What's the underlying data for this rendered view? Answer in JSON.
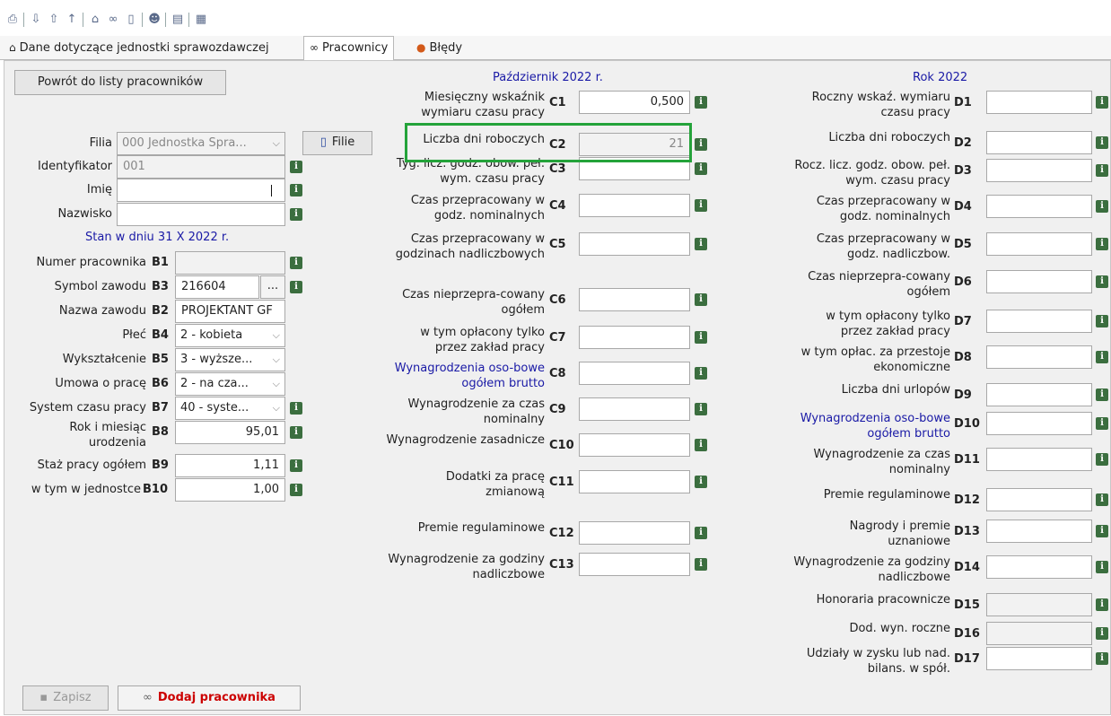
{
  "toolbar": {
    "icons": [
      "print-icon",
      "import-icon",
      "export-icon",
      "upload-icon",
      "home-icon",
      "glasses-icon",
      "bookmark-icon",
      "users-icon",
      "document-icon",
      "binary-icon"
    ]
  },
  "tabs": [
    {
      "label": "Dane dotyczące jednostki sprawozdawczej"
    },
    {
      "label": "Pracownicy"
    },
    {
      "label": "Błędy"
    }
  ],
  "left": {
    "back_button": "Powrót do listy pracowników",
    "filia_label": "Filia",
    "filia_value": "000 Jednostka Spra...",
    "filie_button": "Filie",
    "identyfikator_label": "Identyfikator",
    "identyfikator_value": "001",
    "imie_label": "Imię",
    "imie_value": "",
    "nazwisko_label": "Nazwisko",
    "nazwisko_value": "",
    "stan_header": "Stan w dniu 31 X 2022 r.",
    "rows": [
      {
        "label": "Numer pracownika",
        "code": "B1",
        "value": ""
      },
      {
        "label": "Symbol zawodu",
        "code": "B3",
        "value": "216604",
        "extra": "..."
      },
      {
        "label": "Nazwa zawodu",
        "code": "B2",
        "value": "PROJEKTANT GF"
      },
      {
        "label": "Płeć",
        "code": "B4",
        "value": "2 - kobieta"
      },
      {
        "label": "Wykształcenie",
        "code": "B5",
        "value": "3 - wyższe..."
      },
      {
        "label": "Umowa o pracę",
        "code": "B6",
        "value": "2 - na cza..."
      },
      {
        "label": "System czasu pracy",
        "code": "B7",
        "value": "40 - syste..."
      },
      {
        "label": "Rok i miesiąc urodzenia",
        "code": "B8",
        "value": "95,01"
      },
      {
        "label": "Staż pracy ogółem",
        "code": "B9",
        "value": "1,11"
      },
      {
        "label": "w tym w jednostce",
        "code": "B10",
        "value": "1,00"
      }
    ],
    "save_button": "Zapisz",
    "add_button": "Dodaj pracownika"
  },
  "middle": {
    "header": "Październik 2022 r.",
    "rows": [
      {
        "label": "Miesięczny wskaźnik wymiaru czasu pracy",
        "code": "C1",
        "value": "0,500"
      },
      {
        "label": "Liczba dni roboczych",
        "code": "C2",
        "value": "21"
      },
      {
        "label": "Tyg. licz. godz. obow. peł. wym. czasu pracy",
        "code": "C3",
        "value": ""
      },
      {
        "label": "Czas przepracowany w godz. nominalnych",
        "code": "C4",
        "value": ""
      },
      {
        "label": "Czas przepracowany w godzinach nadliczbowych",
        "code": "C5",
        "value": ""
      },
      {
        "label": "Czas nieprzepra-cowany ogółem",
        "code": "C6",
        "value": ""
      },
      {
        "label": "w tym opłacony tylko przez zakład pracy",
        "code": "C7",
        "value": ""
      },
      {
        "label": "Wynagrodzenia oso-bowe ogółem brutto",
        "code": "C8",
        "value": ""
      },
      {
        "label": "Wynagrodzenie za czas nominalny",
        "code": "C9",
        "value": ""
      },
      {
        "label": "Wynagrodzenie zasadnicze",
        "code": "C10",
        "value": ""
      },
      {
        "label": "Dodatki za pracę zmianową",
        "code": "C11",
        "value": ""
      },
      {
        "label": "Premie regulaminowe",
        "code": "C12",
        "value": ""
      },
      {
        "label": "Wynagrodzenie za godziny nadliczbowe",
        "code": "C13",
        "value": ""
      }
    ]
  },
  "right": {
    "header": "Rok 2022",
    "rows": [
      {
        "label": "Roczny wskaź. wymiaru czasu pracy",
        "code": "D1",
        "value": ""
      },
      {
        "label": "Liczba dni roboczych",
        "code": "D2",
        "value": ""
      },
      {
        "label": "Rocz. licz. godz. obow. peł. wym. czasu pracy",
        "code": "D3",
        "value": ""
      },
      {
        "label": "Czas przepracowany w godz. nominalnych",
        "code": "D4",
        "value": ""
      },
      {
        "label": "Czas przepracowany w godz. nadliczbow.",
        "code": "D5",
        "value": ""
      },
      {
        "label": "Czas nieprzepra-cowany ogółem",
        "code": "D6",
        "value": ""
      },
      {
        "label": "w tym opłacony tylko przez zakład pracy",
        "code": "D7",
        "value": ""
      },
      {
        "label": "w tym opłac. za przestoje ekonomiczne",
        "code": "D8",
        "value": ""
      },
      {
        "label": "Liczba dni urlopów",
        "code": "D9",
        "value": ""
      },
      {
        "label": "Wynagrodzenia oso-bowe ogółem brutto",
        "code": "D10",
        "value": ""
      },
      {
        "label": "Wynagrodzenie za czas nominalny",
        "code": "D11",
        "value": ""
      },
      {
        "label": "Premie regulaminowe",
        "code": "D12",
        "value": ""
      },
      {
        "label": "Nagrody i premie uznaniowe",
        "code": "D13",
        "value": ""
      },
      {
        "label": "Wynagrodzenie za godziny nadliczbowe",
        "code": "D14",
        "value": ""
      },
      {
        "label": "Honoraria pracownicze",
        "code": "D15",
        "value": ""
      },
      {
        "label": "Dod. wyn. roczne",
        "code": "D16",
        "value": ""
      },
      {
        "label": "Udziały w zysku lub nad. bilans. w spół.",
        "code": "D17",
        "value": ""
      }
    ]
  },
  "colors": {
    "accent_text": "#1a1aa6",
    "highlight": "#24a33a",
    "info_icon": "#3b6e3f",
    "add_button_text": "#cc0000"
  }
}
